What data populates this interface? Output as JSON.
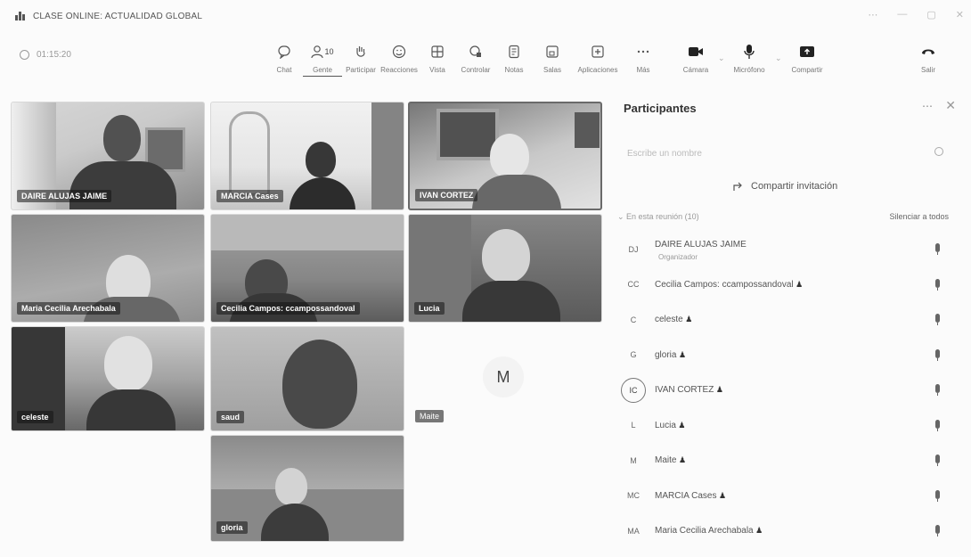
{
  "window": {
    "title": "CLASE ONLINE: ACTUALIDAD GLOBAL",
    "controls": [
      "⋯",
      "—",
      "▢",
      "✕"
    ]
  },
  "toolbar": {
    "timer": "01:15:20",
    "items": [
      {
        "label": "Chat",
        "icon": "chat-icon"
      },
      {
        "label": "Gente",
        "icon": "people-icon",
        "count": "10"
      },
      {
        "label": "Participar",
        "icon": "raise-hand-icon"
      },
      {
        "label": "Reacciones",
        "icon": "smiley-icon"
      },
      {
        "label": "Vista",
        "icon": "grid-icon"
      },
      {
        "label": "Controlar",
        "icon": "control-icon"
      },
      {
        "label": "Notas",
        "icon": "notes-icon"
      },
      {
        "label": "Salas",
        "icon": "rooms-icon"
      },
      {
        "label": "Aplicaciones",
        "icon": "apps-icon"
      },
      {
        "label": "Más",
        "icon": "more-icon"
      },
      {
        "label": "Cámara",
        "icon": "camera-icon"
      },
      {
        "label": "Micrófono",
        "icon": "microphone-icon"
      },
      {
        "label": "Compartir",
        "icon": "share-icon"
      },
      {
        "label": "Salir",
        "icon": "leave-icon"
      }
    ]
  },
  "tiles": [
    {
      "name": "DAIRE ALUJAS JAIME"
    },
    {
      "name": "MARCIA Cases"
    },
    {
      "name": "IVAN CORTEZ"
    },
    {
      "name": "Maria Cecilia Arechabala"
    },
    {
      "name": "Cecilia Campos: ccampossandoval"
    },
    {
      "name": "Lucia"
    },
    {
      "name": "celeste"
    },
    {
      "name": "saud"
    },
    {
      "name": "Maite",
      "initial": "M"
    },
    {
      "name": "gloria"
    }
  ],
  "panel": {
    "title": "Participantes",
    "more": "⋯",
    "close": "✕",
    "search_placeholder": "Escribe un nombre",
    "share_invite": "Compartir invitación",
    "section": "En esta reunión (10)",
    "mute_all": "Silenciar a todos",
    "participants": [
      {
        "initials": "DJ",
        "name": "DAIRE ALUJAS JAIME",
        "role": "Organizador"
      },
      {
        "initials": "CC",
        "name": "Cecilia Campos: ccampossandoval"
      },
      {
        "initials": "C",
        "name": "celeste"
      },
      {
        "initials": "G",
        "name": "gloria"
      },
      {
        "initials": "IC",
        "name": "IVAN CORTEZ"
      },
      {
        "initials": "L",
        "name": "Lucia"
      },
      {
        "initials": "M",
        "name": "Maite"
      },
      {
        "initials": "MC",
        "name": "MARCIA Cases"
      },
      {
        "initials": "MA",
        "name": "Maria Cecilia Arechabala"
      }
    ]
  }
}
